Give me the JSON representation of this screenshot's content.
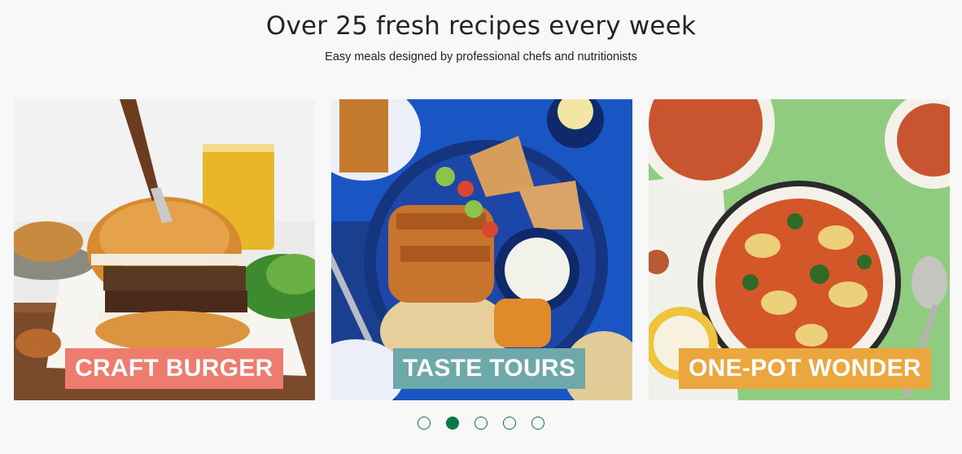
{
  "header": {
    "title": "Over 25 fresh recipes every week",
    "subtitle": "Easy meals designed by professional chefs and nutritionists"
  },
  "cards": [
    {
      "label": "CRAFT BURGER",
      "image": "burger-photo",
      "label_color": "#ed7c6e"
    },
    {
      "label": "TASTE TOURS",
      "image": "mediterranean-plate-photo",
      "label_color": "#6fa8a9"
    },
    {
      "label": "ONE-POT WONDER",
      "image": "tortellini-soup-photo",
      "label_color": "#eba73e"
    }
  ],
  "pagination": {
    "total": 5,
    "active_index": 1,
    "color": "#067a46"
  }
}
